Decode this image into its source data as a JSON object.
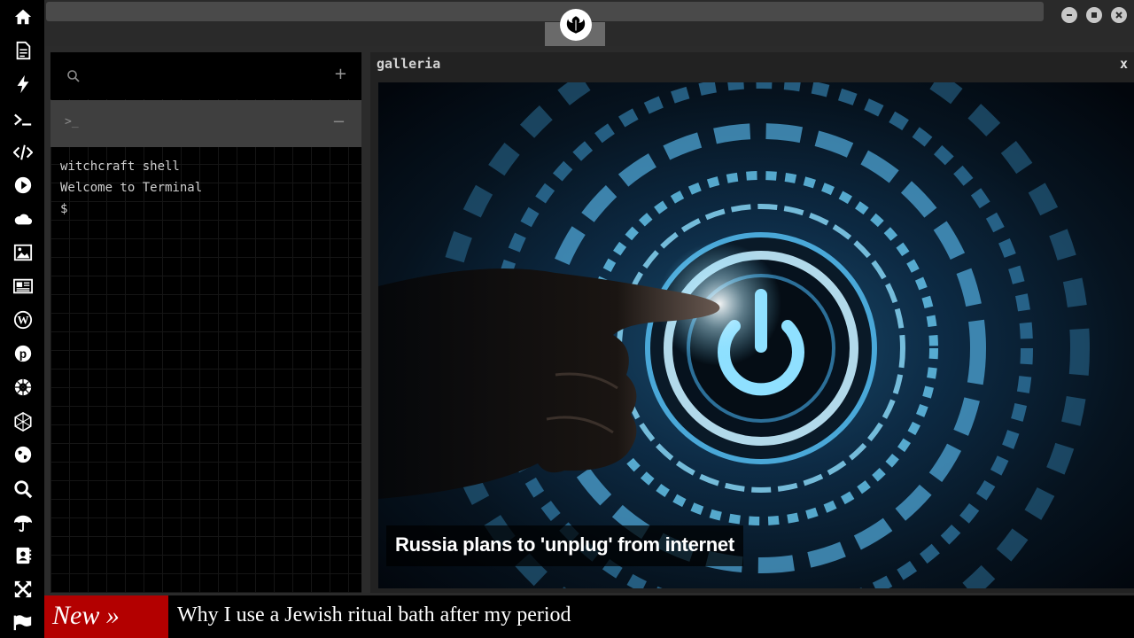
{
  "sidebar": {
    "icons": [
      "home-icon",
      "document-icon",
      "bolt-icon",
      "terminal-icon",
      "code-icon",
      "play-icon",
      "cloud-icon",
      "image-icon",
      "newspaper-icon",
      "wordpress-icon",
      "pinterest-icon",
      "empire-icon",
      "sphere-icon",
      "globe-icon",
      "search-icon",
      "umbrella-icon",
      "contacts-icon",
      "expand-icon",
      "flag-icon"
    ]
  },
  "terminal": {
    "search_icon": "search-icon",
    "add_label": "+",
    "tab_prompt": ">_",
    "minimize_label": "−",
    "lines": [
      "witchcraft shell",
      "Welcome to Terminal",
      "$"
    ]
  },
  "gallery": {
    "title": "galleria",
    "close_label": "x",
    "caption": "Russia plans to 'unplug' from internet"
  },
  "ticker": {
    "label": "New »",
    "headline": "Why I use a Jewish ritual bath after my period"
  },
  "colors": {
    "ticker_label_bg": "#b30000",
    "sidebar_bg": "#000000",
    "accent_blue": "#6fd6ff"
  }
}
